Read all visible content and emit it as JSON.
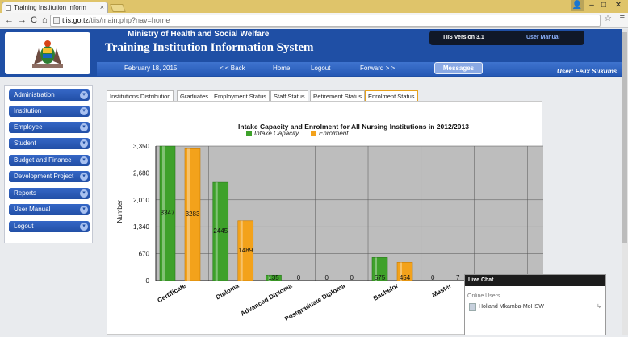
{
  "browser": {
    "tab_title": "Training Institution Inform",
    "tab_close": "×",
    "url_domain": "tiis.go.tz",
    "url_path": "/tiis/main.php?nav=home",
    "win_min": "–",
    "win_max": "□",
    "win_close": "✕"
  },
  "header": {
    "ministry": "Ministry of Health and Social Welfare",
    "system": "Training Institution Information System",
    "version": "TIIS Version 3.1",
    "user_manual": "User Manual",
    "date": "February 18, 2015",
    "back": "< < Back",
    "home": "Home",
    "logout": "Logout",
    "forward": "Forward > >",
    "messages": "Messages",
    "user": "User: Felix Sukums"
  },
  "sidebar": {
    "items": [
      {
        "label": "Administration"
      },
      {
        "label": "Institution"
      },
      {
        "label": "Employee"
      },
      {
        "label": "Student"
      },
      {
        "label": "Budget and Finance"
      },
      {
        "label": "Development Project"
      },
      {
        "label": "Reports"
      },
      {
        "label": "User Manual"
      },
      {
        "label": "Logout"
      }
    ]
  },
  "tabs": [
    "Institutions Distribution",
    "Graduates",
    "Employment Status",
    "Staff Status",
    "Retirement Status",
    "Enrolment Status"
  ],
  "chart_data": {
    "type": "bar",
    "title": "Intake Capacity and Enrolment for All Nursing Institutions in 2012/2013",
    "ylabel": "Number",
    "xlabel": "",
    "categories": [
      "Certificate",
      "Diploma",
      "Advanced Diploma",
      "Postgraduate Diploma",
      "Bachelor",
      "Master"
    ],
    "series": [
      {
        "name": "Intake Capacity",
        "values": [
          3347,
          2445,
          135,
          0,
          575,
          0
        ],
        "color": "#3ea12a"
      },
      {
        "name": "Enrolment",
        "values": [
          3283,
          1489,
          0,
          0,
          454,
          7
        ],
        "color": "#f3a21b"
      }
    ],
    "yticks": [
      "0",
      "670",
      "1,340",
      "2,010",
      "2,680",
      "3,350"
    ],
    "ylim": [
      0,
      3350
    ],
    "grid": true,
    "legend": "top-center"
  },
  "livechat": {
    "title": "Live Chat",
    "subtitle": "Online Users",
    "user": "Holland Mkamba-MoHSW"
  }
}
